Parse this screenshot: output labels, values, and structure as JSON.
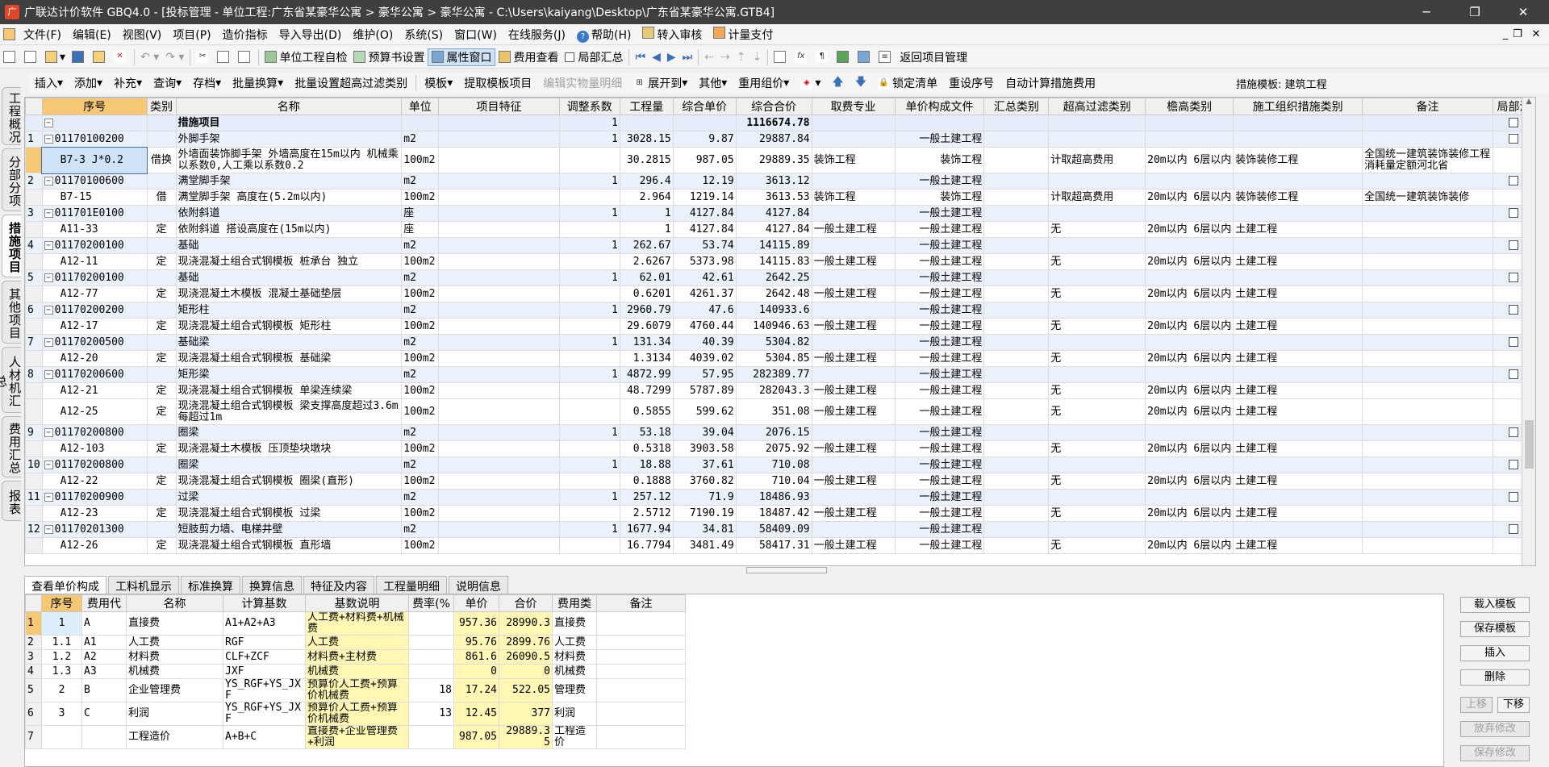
{
  "window": {
    "title": "广联达计价软件 GBQ4.0 - [投标管理 - 单位工程:广东省某豪华公寓 > 豪华公寓 > 豪华公寓 - C:\\Users\\kaiyang\\Desktop\\广东省某豪华公寓.GTB4]",
    "minimize": "─",
    "restore": "❐",
    "close": "✕"
  },
  "menu": [
    "文件(F)",
    "编辑(E)",
    "视图(V)",
    "项目(P)",
    "造价指标",
    "导入导出(D)",
    "维护(O)",
    "系统(S)",
    "窗口(W)",
    "在线服务(J)",
    "帮助(H)",
    "转入审核",
    "计量支付"
  ],
  "toolbar1": {
    "self_check": "单位工程自检",
    "budget_settings": "预算书设置",
    "property_window": "属性窗口",
    "cost_view": "费用查看",
    "dept_summary": "局部汇总",
    "back_project": "返回项目管理"
  },
  "toolbar2": {
    "items": [
      "插入",
      "添加",
      "补充",
      "查询",
      "存档",
      "批量换算",
      "批量设置超高过滤类别",
      "模板",
      "提取模板项目",
      "编辑实物量明细",
      "展开到",
      "其他",
      "重用组价",
      "锁定清单",
      "重设序号",
      "自动计算措施费用"
    ],
    "template_label": "措施模板: 建筑工程"
  },
  "left_tabs": [
    "工程概况",
    "分部分项",
    "措施项目",
    "其他项目",
    "人材机汇总",
    "费用汇总",
    "报表"
  ],
  "grid": {
    "headers": [
      "序号",
      "类别",
      "名称",
      "单位",
      "项目特征",
      "调整系数",
      "工程量",
      "综合单价",
      "综合合价",
      "取费专业",
      "单价构成文件",
      "汇总类别",
      "超高过滤类别",
      "檐高类别",
      "施工组织措施类别",
      "备注",
      "局部汇"
    ],
    "summary_row": {
      "name": "措施项目",
      "coef": "1",
      "total": "1116674.78"
    },
    "rows": [
      {
        "kind": "m",
        "no": "1",
        "code": "01170100200",
        "cat": "",
        "name": "外脚手架",
        "unit": "m2",
        "coef": "1",
        "qty": "3028.15",
        "price": "9.87",
        "total": "29887.84",
        "fee": "",
        "file": "一般土建工程",
        "sumcat": "",
        "hf": "",
        "eh": "",
        "org": "",
        "note": "",
        "cb": true
      },
      {
        "kind": "s",
        "tall": true,
        "sel": true,
        "no": "",
        "code": "B7-3 J*0.2",
        "cat": "借换",
        "name": "外墙面装饰脚手架 外墙高度在15m以内 机械乘以系数0,人工乘以系数0.2",
        "unit": "100m2",
        "coef": "",
        "qty": "30.2815",
        "price": "987.05",
        "total": "29889.35",
        "fee": "装饰工程",
        "file": "装饰工程",
        "sumcat": "",
        "hf": "计取超高费用",
        "eh": "20m以内 6层以内",
        "org": "装饰装修工程",
        "note": "全国统一建筑装饰装修工程消耗量定额河北省",
        "cb": false
      },
      {
        "kind": "m",
        "no": "2",
        "code": "01170100600",
        "cat": "",
        "name": "满堂脚手架",
        "unit": "m2",
        "coef": "1",
        "qty": "296.4",
        "price": "12.19",
        "total": "3613.12",
        "fee": "",
        "file": "一般土建工程",
        "sumcat": "",
        "hf": "",
        "eh": "",
        "org": "",
        "note": "",
        "cb": true
      },
      {
        "kind": "s",
        "no": "",
        "code": "B7-15",
        "cat": "借",
        "name": "满堂脚手架 高度在(5.2m以内)",
        "unit": "100m2",
        "coef": "",
        "qty": "2.964",
        "price": "1219.14",
        "total": "3613.53",
        "fee": "装饰工程",
        "file": "装饰工程",
        "sumcat": "",
        "hf": "计取超高费用",
        "eh": "20m以内 6层以内",
        "org": "装饰装修工程",
        "note": "全国统一建筑装饰装修",
        "cb": false
      },
      {
        "kind": "m",
        "no": "3",
        "code": "011701E0100",
        "cat": "",
        "name": "依附斜道",
        "unit": "座",
        "coef": "1",
        "qty": "1",
        "price": "4127.84",
        "total": "4127.84",
        "fee": "",
        "file": "一般土建工程",
        "sumcat": "",
        "hf": "",
        "eh": "",
        "org": "",
        "note": "",
        "cb": true
      },
      {
        "kind": "s",
        "no": "",
        "code": "A11-33",
        "cat": "定",
        "name": "依附斜道 搭设高度在(15m以内)",
        "unit": "座",
        "coef": "",
        "qty": "1",
        "price": "4127.84",
        "total": "4127.84",
        "fee": "一般土建工程",
        "file": "一般土建工程",
        "sumcat": "",
        "hf": "无",
        "eh": "20m以内 6层以内",
        "org": "土建工程",
        "note": "",
        "cb": false
      },
      {
        "kind": "m",
        "no": "4",
        "code": "01170200100",
        "cat": "",
        "name": "基础",
        "unit": "m2",
        "coef": "1",
        "qty": "262.67",
        "price": "53.74",
        "total": "14115.89",
        "fee": "",
        "file": "一般土建工程",
        "sumcat": "",
        "hf": "",
        "eh": "",
        "org": "",
        "note": "",
        "cb": true
      },
      {
        "kind": "s",
        "no": "",
        "code": "A12-11",
        "cat": "定",
        "name": "现浇混凝土组合式钢模板 桩承台 独立",
        "unit": "100m2",
        "coef": "",
        "qty": "2.6267",
        "price": "5373.98",
        "total": "14115.83",
        "fee": "一般土建工程",
        "file": "一般土建工程",
        "sumcat": "",
        "hf": "无",
        "eh": "20m以内 6层以内",
        "org": "土建工程",
        "note": "",
        "cb": false
      },
      {
        "kind": "m",
        "no": "5",
        "code": "01170200100",
        "cat": "",
        "name": "基础",
        "unit": "m2",
        "coef": "1",
        "qty": "62.01",
        "price": "42.61",
        "total": "2642.25",
        "fee": "",
        "file": "一般土建工程",
        "sumcat": "",
        "hf": "",
        "eh": "",
        "org": "",
        "note": "",
        "cb": true
      },
      {
        "kind": "s",
        "no": "",
        "code": "A12-77",
        "cat": "定",
        "name": "现浇混凝土木模板 混凝土基础垫层",
        "unit": "100m2",
        "coef": "",
        "qty": "0.6201",
        "price": "4261.37",
        "total": "2642.48",
        "fee": "一般土建工程",
        "file": "一般土建工程",
        "sumcat": "",
        "hf": "无",
        "eh": "20m以内 6层以内",
        "org": "土建工程",
        "note": "",
        "cb": false
      },
      {
        "kind": "m",
        "no": "6",
        "code": "01170200200",
        "cat": "",
        "name": "矩形柱",
        "unit": "m2",
        "coef": "1",
        "qty": "2960.79",
        "price": "47.6",
        "total": "140933.6",
        "fee": "",
        "file": "一般土建工程",
        "sumcat": "",
        "hf": "",
        "eh": "",
        "org": "",
        "note": "",
        "cb": true
      },
      {
        "kind": "s",
        "no": "",
        "code": "A12-17",
        "cat": "定",
        "name": "现浇混凝土组合式钢模板 矩形柱",
        "unit": "100m2",
        "coef": "",
        "qty": "29.6079",
        "price": "4760.44",
        "total": "140946.63",
        "fee": "一般土建工程",
        "file": "一般土建工程",
        "sumcat": "",
        "hf": "无",
        "eh": "20m以内 6层以内",
        "org": "土建工程",
        "note": "",
        "cb": false
      },
      {
        "kind": "m",
        "no": "7",
        "code": "01170200500",
        "cat": "",
        "name": "基础梁",
        "unit": "m2",
        "coef": "1",
        "qty": "131.34",
        "price": "40.39",
        "total": "5304.82",
        "fee": "",
        "file": "一般土建工程",
        "sumcat": "",
        "hf": "",
        "eh": "",
        "org": "",
        "note": "",
        "cb": true
      },
      {
        "kind": "s",
        "no": "",
        "code": "A12-20",
        "cat": "定",
        "name": "现浇混凝土组合式钢模板 基础梁",
        "unit": "100m2",
        "coef": "",
        "qty": "1.3134",
        "price": "4039.02",
        "total": "5304.85",
        "fee": "一般土建工程",
        "file": "一般土建工程",
        "sumcat": "",
        "hf": "无",
        "eh": "20m以内 6层以内",
        "org": "土建工程",
        "note": "",
        "cb": false
      },
      {
        "kind": "m",
        "no": "8",
        "code": "01170200600",
        "cat": "",
        "name": "矩形梁",
        "unit": "m2",
        "coef": "1",
        "qty": "4872.99",
        "price": "57.95",
        "total": "282389.77",
        "fee": "",
        "file": "一般土建工程",
        "sumcat": "",
        "hf": "",
        "eh": "",
        "org": "",
        "note": "",
        "cb": true
      },
      {
        "kind": "s",
        "no": "",
        "code": "A12-21",
        "cat": "定",
        "name": "现浇混凝土组合式钢模板 单梁连续梁",
        "unit": "100m2",
        "coef": "",
        "qty": "48.7299",
        "price": "5787.89",
        "total": "282043.3",
        "fee": "一般土建工程",
        "file": "一般土建工程",
        "sumcat": "",
        "hf": "无",
        "eh": "20m以内 6层以内",
        "org": "土建工程",
        "note": "",
        "cb": false
      },
      {
        "kind": "s",
        "tall": true,
        "no": "",
        "code": "A12-25",
        "cat": "定",
        "name": "现浇混凝土组合式钢模板 梁支撑高度超过3.6m每超过1m",
        "unit": "100m2",
        "coef": "",
        "qty": "0.5855",
        "price": "599.62",
        "total": "351.08",
        "fee": "一般土建工程",
        "file": "一般土建工程",
        "sumcat": "",
        "hf": "无",
        "eh": "20m以内 6层以内",
        "org": "土建工程",
        "note": "",
        "cb": false
      },
      {
        "kind": "m",
        "no": "9",
        "code": "01170200800",
        "cat": "",
        "name": "圈梁",
        "unit": "m2",
        "coef": "1",
        "qty": "53.18",
        "price": "39.04",
        "total": "2076.15",
        "fee": "",
        "file": "一般土建工程",
        "sumcat": "",
        "hf": "",
        "eh": "",
        "org": "",
        "note": "",
        "cb": true
      },
      {
        "kind": "s",
        "no": "",
        "code": "A12-103",
        "cat": "定",
        "name": "现浇混凝土木模板 压顶垫块墩块",
        "unit": "100m2",
        "coef": "",
        "qty": "0.5318",
        "price": "3903.58",
        "total": "2075.92",
        "fee": "一般土建工程",
        "file": "一般土建工程",
        "sumcat": "",
        "hf": "无",
        "eh": "20m以内 6层以内",
        "org": "土建工程",
        "note": "",
        "cb": false
      },
      {
        "kind": "m",
        "no": "10",
        "code": "01170200800",
        "cat": "",
        "name": "圈梁",
        "unit": "m2",
        "coef": "1",
        "qty": "18.88",
        "price": "37.61",
        "total": "710.08",
        "fee": "",
        "file": "一般土建工程",
        "sumcat": "",
        "hf": "",
        "eh": "",
        "org": "",
        "note": "",
        "cb": true
      },
      {
        "kind": "s",
        "no": "",
        "code": "A12-22",
        "cat": "定",
        "name": "现浇混凝土组合式钢模板 圈梁(直形)",
        "unit": "100m2",
        "coef": "",
        "qty": "0.1888",
        "price": "3760.82",
        "total": "710.04",
        "fee": "一般土建工程",
        "file": "一般土建工程",
        "sumcat": "",
        "hf": "无",
        "eh": "20m以内 6层以内",
        "org": "土建工程",
        "note": "",
        "cb": false
      },
      {
        "kind": "m",
        "no": "11",
        "code": "01170200900",
        "cat": "",
        "name": "过梁",
        "unit": "m2",
        "coef": "1",
        "qty": "257.12",
        "price": "71.9",
        "total": "18486.93",
        "fee": "",
        "file": "一般土建工程",
        "sumcat": "",
        "hf": "",
        "eh": "",
        "org": "",
        "note": "",
        "cb": true
      },
      {
        "kind": "s",
        "no": "",
        "code": "A12-23",
        "cat": "定",
        "name": "现浇混凝土组合式钢模板 过梁",
        "unit": "100m2",
        "coef": "",
        "qty": "2.5712",
        "price": "7190.19",
        "total": "18487.42",
        "fee": "一般土建工程",
        "file": "一般土建工程",
        "sumcat": "",
        "hf": "无",
        "eh": "20m以内 6层以内",
        "org": "土建工程",
        "note": "",
        "cb": false
      },
      {
        "kind": "m",
        "no": "12",
        "code": "01170201300",
        "cat": "",
        "name": "短肢剪力墙、电梯井壁",
        "unit": "m2",
        "coef": "1",
        "qty": "1677.94",
        "price": "34.81",
        "total": "58409.09",
        "fee": "",
        "file": "一般土建工程",
        "sumcat": "",
        "hf": "",
        "eh": "",
        "org": "",
        "note": "",
        "cb": true
      },
      {
        "kind": "s",
        "no": "",
        "code": "A12-26",
        "cat": "定",
        "name": "现浇混凝土组合式钢模板 直形墙",
        "unit": "100m2",
        "coef": "",
        "qty": "16.7794",
        "price": "3481.49",
        "total": "58417.31",
        "fee": "一般土建工程",
        "file": "一般土建工程",
        "sumcat": "",
        "hf": "无",
        "eh": "20m以内 6层以内",
        "org": "土建工程",
        "note": "",
        "cb": false
      }
    ]
  },
  "bottom_tabs": [
    "查看单价构成",
    "工料机显示",
    "标准换算",
    "换算信息",
    "特征及内容",
    "工程量明细",
    "说明信息"
  ],
  "lower": {
    "headers": [
      "序号",
      "费用代",
      "名称",
      "计算基数",
      "基数说明",
      "费率(%",
      "单价",
      "合价",
      "费用类",
      "备注"
    ],
    "rows": [
      {
        "r": "1",
        "no": "1",
        "code": "A",
        "name": "直接费",
        "base": "A1+A2+A3",
        "desc": "人工费+材料费+机械费",
        "rate": "",
        "price": "957.36",
        "total": "28990.3",
        "type": "直接费",
        "note": "",
        "tall": true
      },
      {
        "r": "2",
        "no": "1.1",
        "code": "A1",
        "name": "人工费",
        "base": "RGF",
        "desc": "人工费",
        "rate": "",
        "price": "95.76",
        "total": "2899.76",
        "type": "人工费",
        "note": ""
      },
      {
        "r": "3",
        "no": "1.2",
        "code": "A2",
        "name": "材料费",
        "base": "CLF+ZCF",
        "desc": "材料费+主材费",
        "rate": "",
        "price": "861.6",
        "total": "26090.5",
        "type": "材料费",
        "note": ""
      },
      {
        "r": "4",
        "no": "1.3",
        "code": "A3",
        "name": "机械费",
        "base": "JXF",
        "desc": "机械费",
        "rate": "",
        "price": "0",
        "total": "0",
        "type": "机械费",
        "note": ""
      },
      {
        "r": "5",
        "no": "2",
        "code": "B",
        "name": "企业管理费",
        "base": "YS_RGF+YS_JXF",
        "desc": "预算价人工费+预算价机械费",
        "rate": "18",
        "price": "17.24",
        "total": "522.05",
        "type": "管理费",
        "note": "",
        "tall": true
      },
      {
        "r": "6",
        "no": "3",
        "code": "C",
        "name": "利润",
        "base": "YS_RGF+YS_JXF",
        "desc": "预算价人工费+预算价机械费",
        "rate": "13",
        "price": "12.45",
        "total": "377",
        "type": "利润",
        "note": "",
        "tall": true
      },
      {
        "r": "7",
        "no": "",
        "code": "",
        "name": "工程造价",
        "base": "A+B+C",
        "desc": "直接费+企业管理费+利润",
        "rate": "",
        "price": "987.05",
        "total": "29889.35",
        "type": "工程造价",
        "note": "",
        "tall": true
      }
    ]
  },
  "right_buttons": [
    "载入模板",
    "保存模板",
    "插入",
    "删除",
    "上移",
    "下移",
    "放弃修改",
    "保存修改"
  ]
}
